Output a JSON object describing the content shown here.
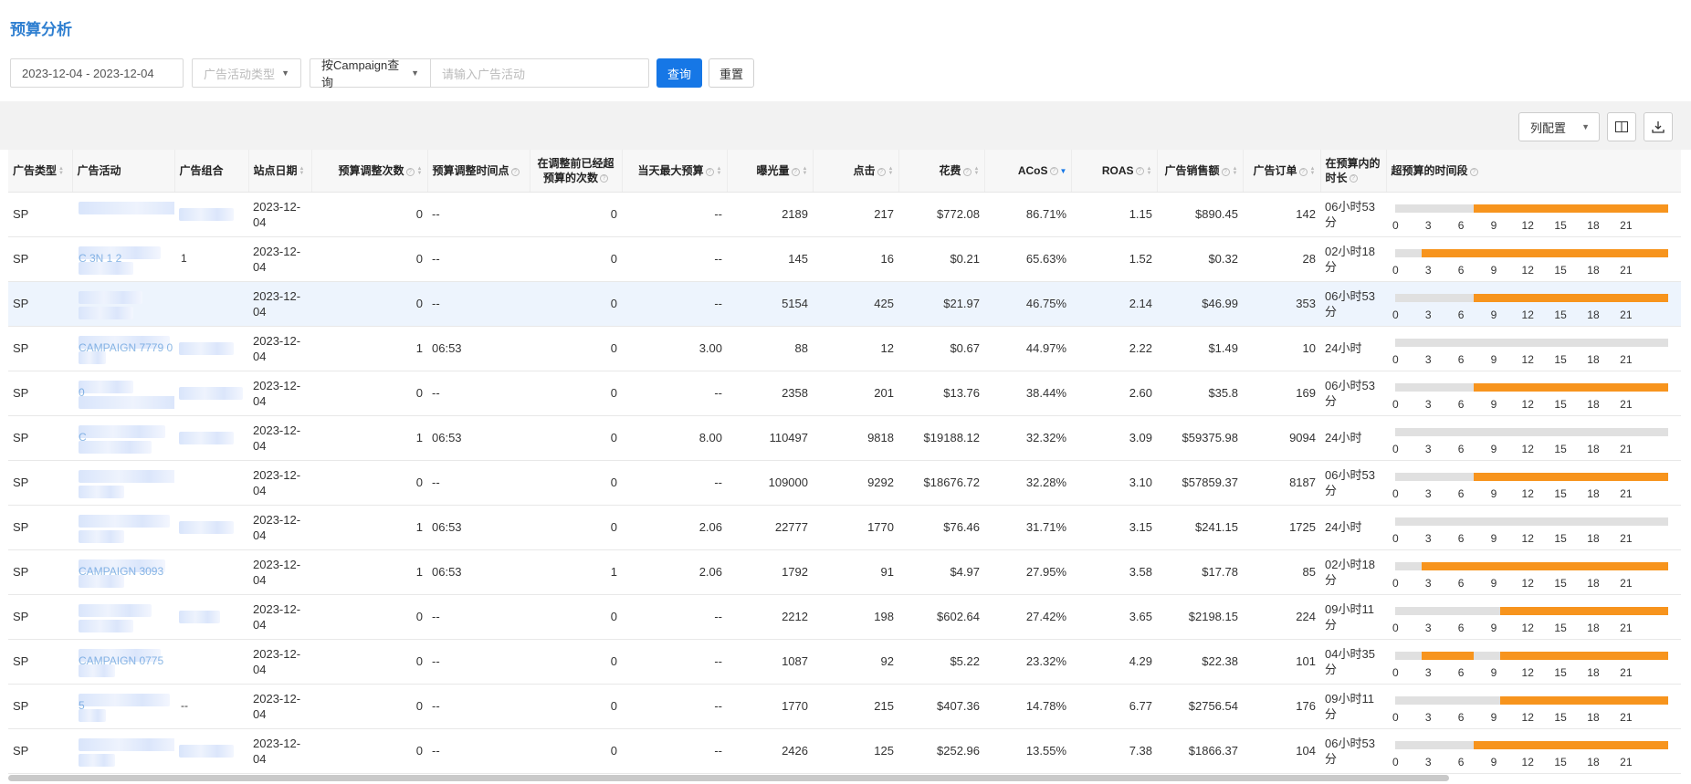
{
  "page": {
    "title": "预算分析"
  },
  "filters": {
    "date_range": "2023-12-04 - 2023-12-04",
    "campaign_type_placeholder": "广告活动类型",
    "query_mode": "按Campaign查询",
    "search_placeholder": "请输入广告活动",
    "search_button": "查询",
    "reset_button": "重置"
  },
  "toolbar": {
    "column_config": "列配置"
  },
  "table": {
    "headers": {
      "ad_type": "广告类型",
      "campaign": "广告活动",
      "ad_group": "广告组合",
      "site_date": "站点日期",
      "adjust_count": "预算调整次数",
      "adjust_time": "预算调整时间点",
      "over_before_adjust": "在调整前已经超预算的次数",
      "max_budget": "当天最大预算",
      "impressions": "曝光量",
      "clicks": "点击",
      "spend": "花费",
      "acos": "ACoS",
      "roas": "ROAS",
      "sales": "广告销售额",
      "orders": "广告订单",
      "in_budget_duration": "在预算内的时长",
      "over_budget_period": "超预算的时间段"
    },
    "tick_labels": [
      "0",
      "3",
      "6",
      "9",
      "12",
      "15",
      "18",
      "21"
    ],
    "rows": [
      {
        "type": "SP",
        "campaign": "",
        "group": "",
        "date": "2023-12-04",
        "adj": "0",
        "adjtime": "--",
        "over": "0",
        "max": "--",
        "imp": "2189",
        "clk": "217",
        "spend": "$772.08",
        "acos": "86.71%",
        "roas": "1.15",
        "sales": "$890.45",
        "orders": "142",
        "dur": "06小时53分",
        "segments": [
          [
            6.9,
            24
          ]
        ]
      },
      {
        "type": "SP",
        "campaign": "C            3N 1 2",
        "group": "1",
        "date": "2023-12-04",
        "adj": "0",
        "adjtime": "--",
        "over": "0",
        "max": "--",
        "imp": "145",
        "clk": "16",
        "spend": "$0.21",
        "acos": "65.63%",
        "roas": "1.52",
        "sales": "$0.32",
        "orders": "28",
        "dur": "02小时18分",
        "segments": [
          [
            2.3,
            24
          ]
        ]
      },
      {
        "type": "SP",
        "campaign": "",
        "group": "",
        "date": "2023-12-04",
        "adj": "0",
        "adjtime": "--",
        "over": "0",
        "max": "--",
        "imp": "5154",
        "clk": "425",
        "spend": "$21.97",
        "acos": "46.75%",
        "roas": "2.14",
        "sales": "$46.99",
        "orders": "353",
        "dur": "06小时53分",
        "segments": [
          [
            6.9,
            24
          ]
        ]
      },
      {
        "type": "SP",
        "campaign": "CAMPAIGN 7779 0",
        "group": "",
        "date": "2023-12-04",
        "adj": "1",
        "adjtime": "06:53",
        "over": "0",
        "max": "3.00",
        "imp": "88",
        "clk": "12",
        "spend": "$0.67",
        "acos": "44.97%",
        "roas": "2.22",
        "sales": "$1.49",
        "orders": "10",
        "dur": "24小时",
        "segments": []
      },
      {
        "type": "SP",
        "campaign": "0",
        "group": "",
        "date": "2023-12-04",
        "adj": "0",
        "adjtime": "--",
        "over": "0",
        "max": "--",
        "imp": "2358",
        "clk": "201",
        "spend": "$13.76",
        "acos": "38.44%",
        "roas": "2.60",
        "sales": "$35.8",
        "orders": "169",
        "dur": "06小时53分",
        "segments": [
          [
            6.9,
            24
          ]
        ]
      },
      {
        "type": "SP",
        "campaign": "C",
        "group": "",
        "date": "2023-12-04",
        "adj": "1",
        "adjtime": "06:53",
        "over": "0",
        "max": "8.00",
        "imp": "110497",
        "clk": "9818",
        "spend": "$19188.12",
        "acos": "32.32%",
        "roas": "3.09",
        "sales": "$59375.98",
        "orders": "9094",
        "dur": "24小时",
        "segments": []
      },
      {
        "type": "SP",
        "campaign": "",
        "group": "",
        "date": "2023-12-04",
        "adj": "0",
        "adjtime": "--",
        "over": "0",
        "max": "--",
        "imp": "109000",
        "clk": "9292",
        "spend": "$18676.72",
        "acos": "32.28%",
        "roas": "3.10",
        "sales": "$57859.37",
        "orders": "8187",
        "dur": "06小时53分",
        "segments": [
          [
            6.9,
            24
          ]
        ]
      },
      {
        "type": "SP",
        "campaign": "",
        "group": "",
        "date": "2023-12-04",
        "adj": "1",
        "adjtime": "06:53",
        "over": "0",
        "max": "2.06",
        "imp": "22777",
        "clk": "1770",
        "spend": "$76.46",
        "acos": "31.71%",
        "roas": "3.15",
        "sales": "$241.15",
        "orders": "1725",
        "dur": "24小时",
        "segments": []
      },
      {
        "type": "SP",
        "campaign": "CAMPAIGN 3093",
        "group": "",
        "date": "2023-12-04",
        "adj": "1",
        "adjtime": "06:53",
        "over": "1",
        "max": "2.06",
        "imp": "1792",
        "clk": "91",
        "spend": "$4.97",
        "acos": "27.95%",
        "roas": "3.58",
        "sales": "$17.78",
        "orders": "85",
        "dur": "02小时18分",
        "segments": [
          [
            2.3,
            24
          ]
        ]
      },
      {
        "type": "SP",
        "campaign": "",
        "group": "",
        "date": "2023-12-04",
        "adj": "0",
        "adjtime": "--",
        "over": "0",
        "max": "--",
        "imp": "2212",
        "clk": "198",
        "spend": "$602.64",
        "acos": "27.42%",
        "roas": "3.65",
        "sales": "$2198.15",
        "orders": "224",
        "dur": "09小时11分",
        "segments": [
          [
            9.2,
            24
          ]
        ]
      },
      {
        "type": "SP",
        "campaign": "CAMPAIGN 0775",
        "group": "",
        "date": "2023-12-04",
        "adj": "0",
        "adjtime": "--",
        "over": "0",
        "max": "--",
        "imp": "1087",
        "clk": "92",
        "spend": "$5.22",
        "acos": "23.32%",
        "roas": "4.29",
        "sales": "$22.38",
        "orders": "101",
        "dur": "04小时35分",
        "segments": [
          [
            2.3,
            6.9
          ],
          [
            9.2,
            24
          ]
        ]
      },
      {
        "type": "SP",
        "campaign": "5",
        "group": "--",
        "date": "2023-12-04",
        "adj": "0",
        "adjtime": "--",
        "over": "0",
        "max": "--",
        "imp": "1770",
        "clk": "215",
        "spend": "$407.36",
        "acos": "14.78%",
        "roas": "6.77",
        "sales": "$2756.54",
        "orders": "176",
        "dur": "09小时11分",
        "segments": [
          [
            9.2,
            24
          ]
        ]
      },
      {
        "type": "SP",
        "campaign": "",
        "group": "",
        "date": "2023-12-04",
        "adj": "0",
        "adjtime": "--",
        "over": "0",
        "max": "--",
        "imp": "2426",
        "clk": "125",
        "spend": "$252.96",
        "acos": "13.55%",
        "roas": "7.38",
        "sales": "$1866.37",
        "orders": "104",
        "dur": "06小时53分",
        "segments": [
          [
            6.9,
            24
          ]
        ]
      }
    ]
  }
}
